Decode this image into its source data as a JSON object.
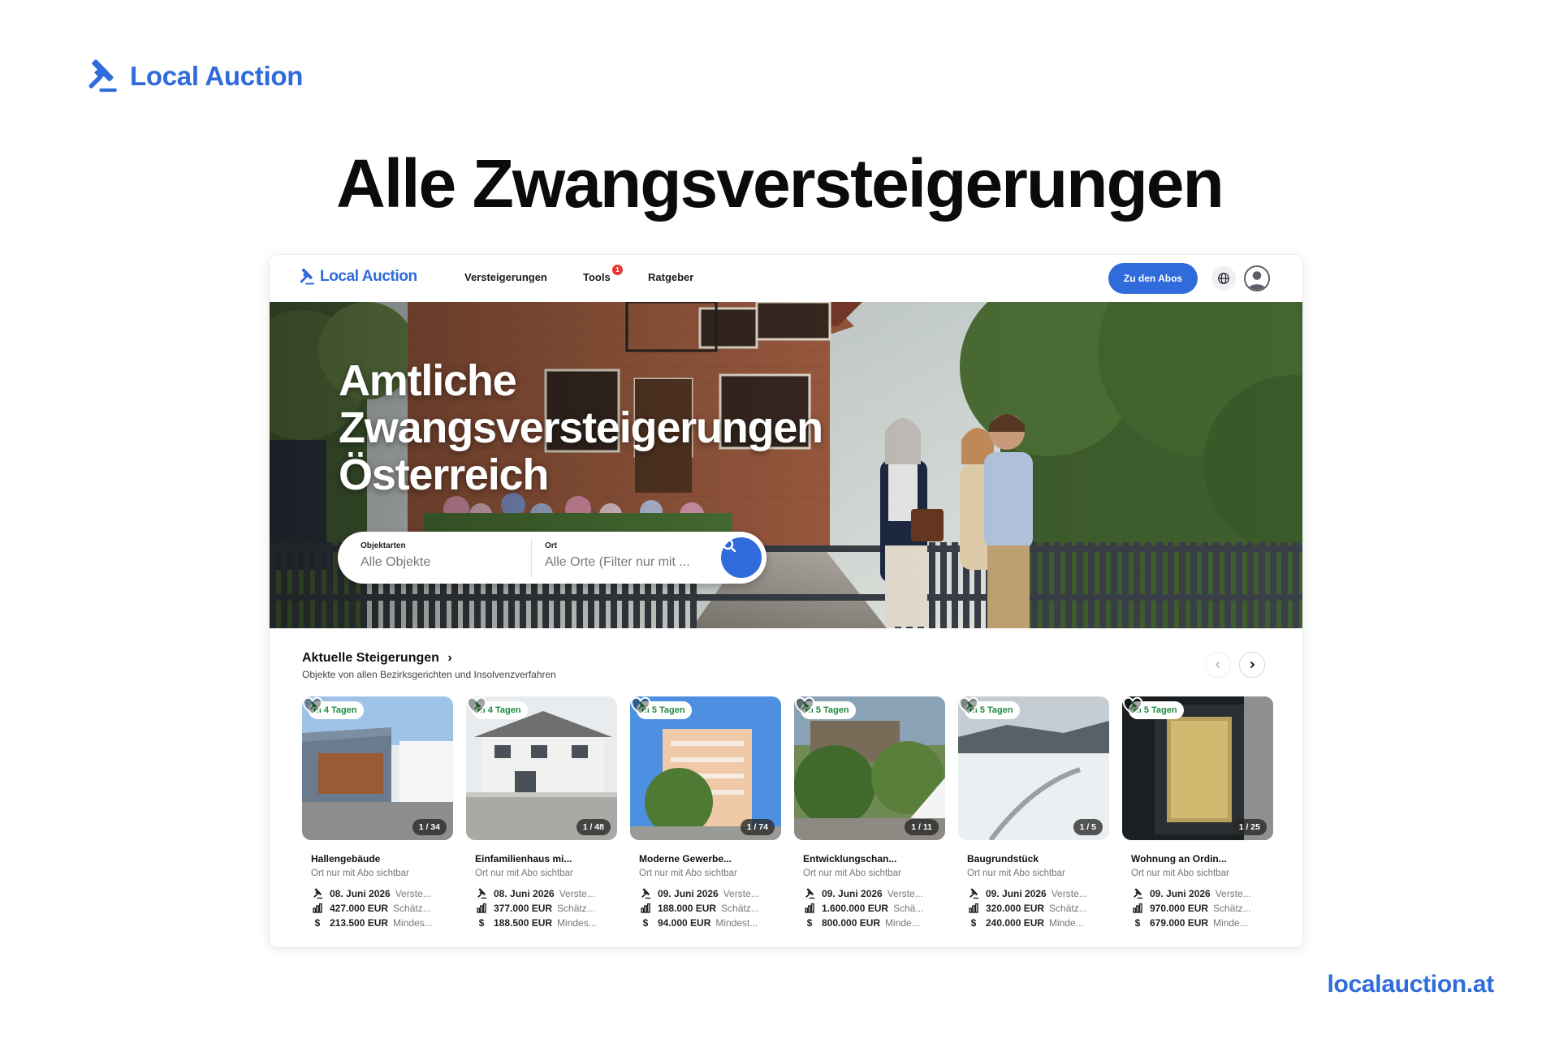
{
  "brand": {
    "name": "Local Auction"
  },
  "headline": "Alle Zwangsversteigerungen",
  "domain": "localauction.at",
  "app": {
    "logo": "Local Auction",
    "nav": [
      {
        "label": "Versteigerungen"
      },
      {
        "label": "Tools",
        "badge": "1"
      },
      {
        "label": "Ratgeber"
      }
    ],
    "cta": "Zu den Abos",
    "icons": {
      "language": "globe-icon",
      "account": "user-avatar-icon"
    },
    "accent": "#2f6bdb"
  },
  "hero": {
    "title_lines": [
      "Amtliche",
      "Zwangsversteigerungen",
      "Österreich"
    ],
    "search": {
      "type_label": "Objektarten",
      "type_value": "Alle Objekte",
      "place_label": "Ort",
      "place_value": "Alle Orte (Filter nur mit ..."
    }
  },
  "section": {
    "title": "Aktuelle Steigerungen",
    "subtitle": "Objekte von allen Bezirksgerichten und Insolvenzverfahren"
  },
  "listings": [
    {
      "days": "in 4 Tagen",
      "counter": "1 / 34",
      "title": "Hallengebäude",
      "location": "Ort nur mit Abo sichtbar",
      "date": "08. Juni 2026",
      "date_label": "Verste...",
      "estimate": "427.000 EUR",
      "estimate_label": "Schätz...",
      "minimum": "213.500 EUR",
      "minimum_label": "Mindes..."
    },
    {
      "days": "in 4 Tagen",
      "counter": "1 / 48",
      "title": "Einfamilienhaus mi...",
      "location": "Ort nur mit Abo sichtbar",
      "date": "08. Juni 2026",
      "date_label": "Verste...",
      "estimate": "377.000 EUR",
      "estimate_label": "Schätz...",
      "minimum": "188.500 EUR",
      "minimum_label": "Mindes..."
    },
    {
      "days": "in 5 Tagen",
      "counter": "1 / 74",
      "title": "Moderne Gewerbe...",
      "location": "Ort nur mit Abo sichtbar",
      "date": "09. Juni 2026",
      "date_label": "Verste...",
      "estimate": "188.000 EUR",
      "estimate_label": "Schätz...",
      "minimum": "94.000 EUR",
      "minimum_label": "Mindest..."
    },
    {
      "days": "in 5 Tagen",
      "counter": "1 / 11",
      "title": "Entwicklungschan...",
      "location": "Ort nur mit Abo sichtbar",
      "date": "09. Juni 2026",
      "date_label": "Verste...",
      "estimate": "1.600.000 EUR",
      "estimate_label": "Schä...",
      "minimum": "800.000 EUR",
      "minimum_label": "Minde..."
    },
    {
      "days": "in 5 Tagen",
      "counter": "1 / 5",
      "title": "Baugrundstück",
      "location": "Ort nur mit Abo sichtbar",
      "date": "09. Juni 2026",
      "date_label": "Verste...",
      "estimate": "320.000 EUR",
      "estimate_label": "Schätz...",
      "minimum": "240.000 EUR",
      "minimum_label": "Minde..."
    },
    {
      "days": "in 5 Tagen",
      "counter": "1 / 25",
      "title": "Wohnung an Ordin...",
      "location": "Ort nur mit Abo sichtbar",
      "date": "09. Juni 2026",
      "date_label": "Verste...",
      "estimate": "970.000 EUR",
      "estimate_label": "Schätz...",
      "minimum": "679.000 EUR",
      "minimum_label": "Minde..."
    }
  ]
}
